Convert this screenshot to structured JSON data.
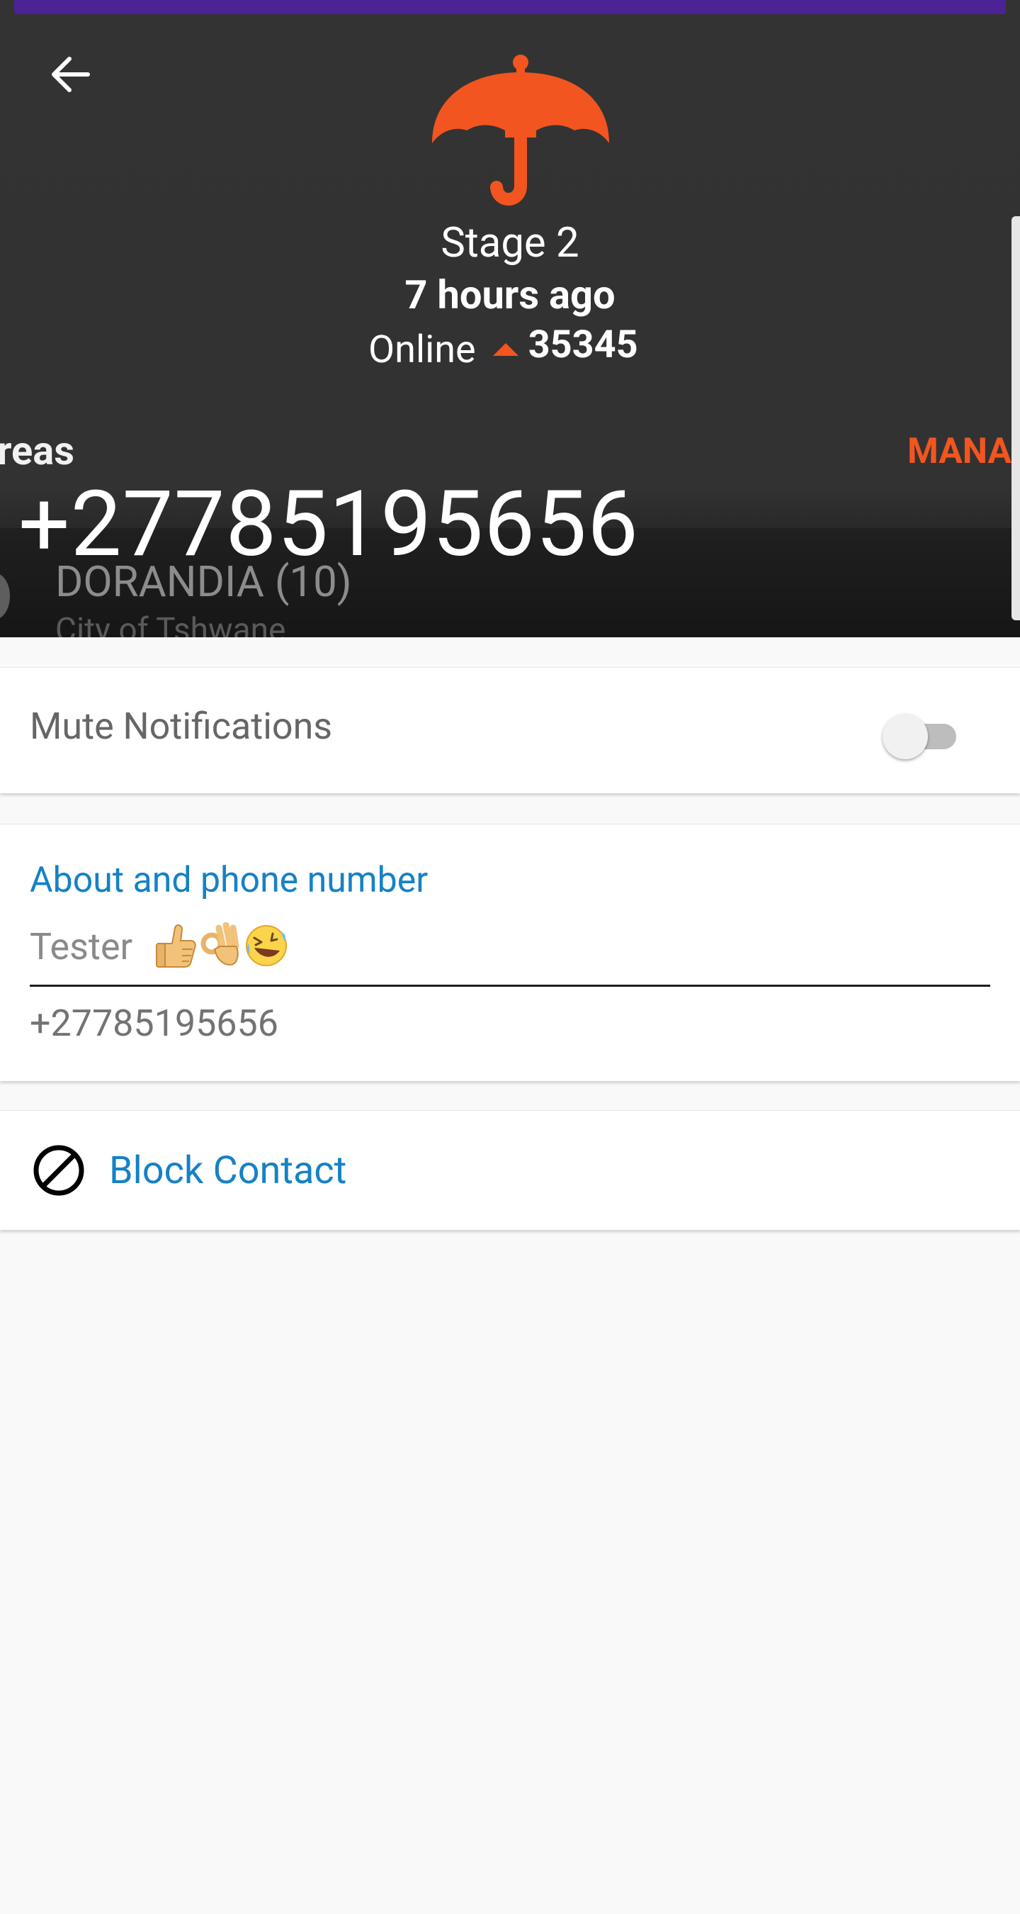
{
  "header": {
    "back_icon": "arrow-left-icon",
    "hero_icon": "umbrella-icon",
    "stage": "Stage 2",
    "updated": "7 hours ago",
    "status": "Online",
    "trend_icon": "triangle-up-icon",
    "count": "35345",
    "areas_partial": "reas",
    "manage_partial": "MANAG",
    "area_name": "DORANDIA (10)",
    "area_city": "City of Tshwane",
    "phone_large": "+27785195656"
  },
  "mute": {
    "label": "Mute Notifications",
    "enabled": false
  },
  "about": {
    "title": "About and phone number",
    "text": "Tester",
    "emojis": [
      "thumbs-up-emoji",
      "ok-hand-emoji",
      "rolling-laughing-emoji"
    ],
    "phone": "+27785195656"
  },
  "block": {
    "icon": "block-icon",
    "label": "Block Contact"
  },
  "colors": {
    "accent_orange": "#f2551f",
    "link_blue": "#1681c6",
    "header_bg": "#333333",
    "purple_bar": "#4b2394"
  }
}
